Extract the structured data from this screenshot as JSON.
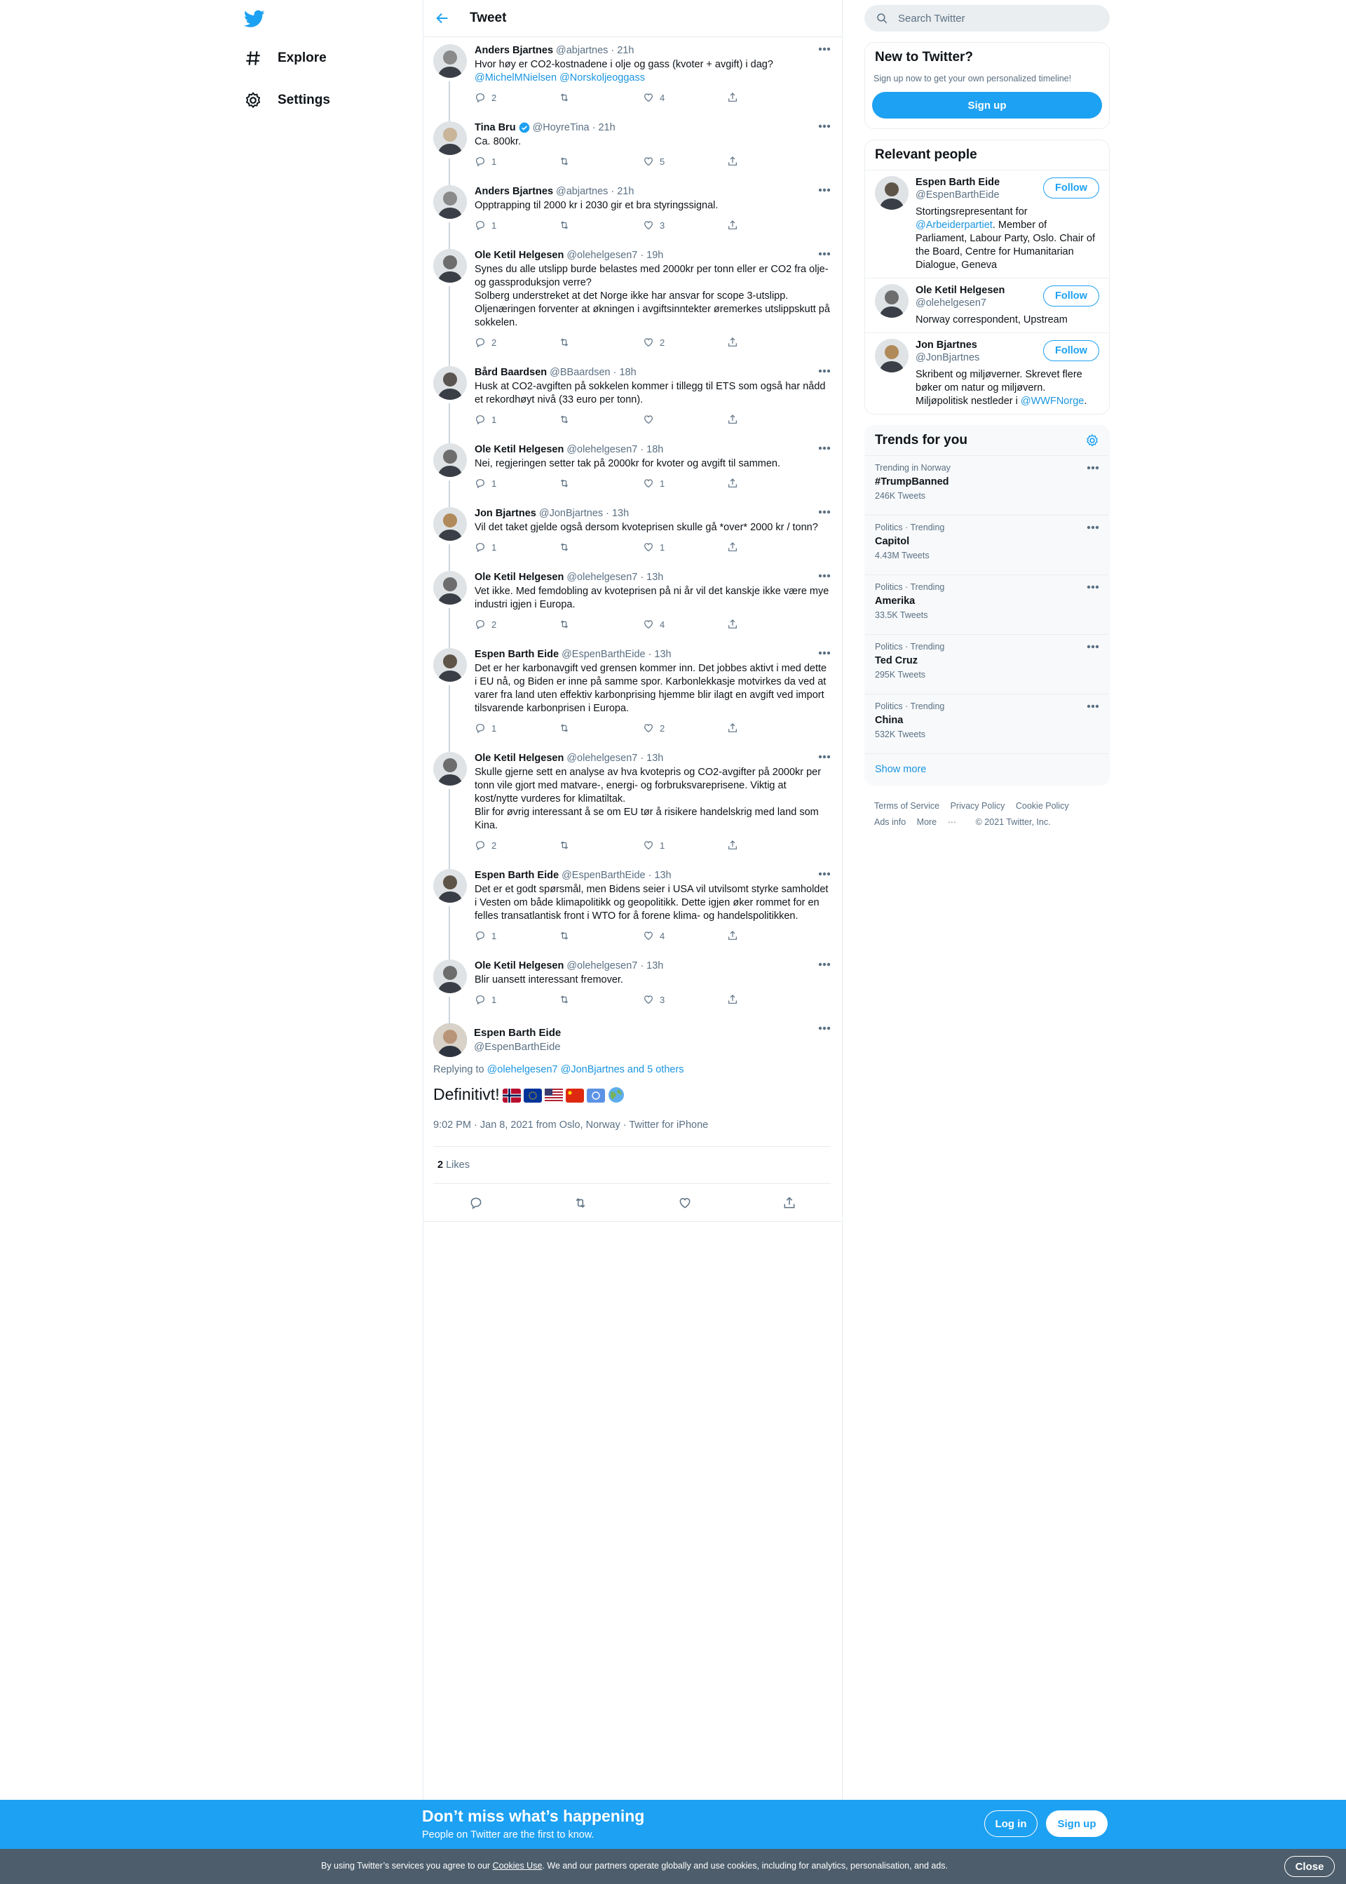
{
  "nav": {
    "explore_label": "Explore",
    "settings_label": "Settings"
  },
  "header": {
    "title": "Tweet"
  },
  "thread": [
    {
      "name": "Anders Bjartnes",
      "handle": "@abjartnes",
      "time": "21h",
      "text": "Hvor høy er CO2-kostnadene i olje og gass (kvoter + avgift) i dag?",
      "mentions": "@MichelMNielsen @Norskoljeoggass",
      "replies": "2",
      "retweets": "",
      "likes": "4",
      "avatar_color": "#8a8a8a",
      "verified": false
    },
    {
      "name": "Tina Bru",
      "handle": "@HoyreTina",
      "time": "21h",
      "text": "Ca. 800kr.",
      "mentions": "",
      "replies": "1",
      "retweets": "",
      "likes": "5",
      "avatar_color": "#c8b59a",
      "verified": true
    },
    {
      "name": "Anders Bjartnes",
      "handle": "@abjartnes",
      "time": "21h",
      "text": "Opptrapping til 2000 kr i 2030 gir et bra styringssignal.",
      "mentions": "",
      "replies": "1",
      "retweets": "",
      "likes": "3",
      "avatar_color": "#8a8a8a",
      "verified": false
    },
    {
      "name": "Ole Ketil Helgesen",
      "handle": "@olehelgesen7",
      "time": "19h",
      "text": "Synes du alle utslipp burde belastes med 2000kr per tonn eller er CO2 fra olje- og gassproduksjon verre?\nSolberg understreket at det Norge ikke har ansvar for scope 3-utslipp.\nOljenæringen forventer at økningen i avgiftsinntekter øremerkes utslippskutt på sokkelen.",
      "mentions": "",
      "replies": "2",
      "retweets": "",
      "likes": "2",
      "avatar_color": "#6d6d6d",
      "verified": false
    },
    {
      "name": "Bård Baardsen",
      "handle": "@BBaardsen",
      "time": "18h",
      "text": "Husk at CO2-avgiften på sokkelen kommer i tillegg til ETS som også har nådd et rekordhøyt nivå (33 euro per tonn).",
      "mentions": "",
      "replies": "1",
      "retweets": "",
      "likes": "",
      "avatar_color": "#5a5550",
      "verified": false
    },
    {
      "name": "Ole Ketil Helgesen",
      "handle": "@olehelgesen7",
      "time": "18h",
      "text": "Nei, regjeringen setter tak på 2000kr for kvoter og avgift til sammen.",
      "mentions": "",
      "replies": "1",
      "retweets": "",
      "likes": "1",
      "avatar_color": "#6d6d6d",
      "verified": false
    },
    {
      "name": "Jon Bjartnes",
      "handle": "@JonBjartnes",
      "time": "13h",
      "text": "Vil det taket gjelde også dersom kvoteprisen skulle gå *over* 2000 kr / tonn?",
      "mentions": "",
      "replies": "1",
      "retweets": "",
      "likes": "1",
      "avatar_color": "#b08a5a",
      "verified": false
    },
    {
      "name": "Ole Ketil Helgesen",
      "handle": "@olehelgesen7",
      "time": "13h",
      "text": "Vet ikke. Med femdobling av kvoteprisen på ni år vil det kanskje ikke være mye industri igjen i Europa.",
      "mentions": "",
      "replies": "2",
      "retweets": "",
      "likes": "4",
      "avatar_color": "#6d6d6d",
      "verified": false
    },
    {
      "name": "Espen Barth Eide",
      "handle": "@EspenBarthEide",
      "time": "13h",
      "text": "Det er her karbonavgift ved grensen kommer inn. Det jobbes aktivt i med dette i EU nå, og Biden er inne på samme spor. Karbonlekkasje motvirkes da ved at varer fra land uten effektiv karbonprising hjemme blir ilagt en avgift ved import tilsvarende karbonprisen i Europa.",
      "mentions": "",
      "replies": "1",
      "retweets": "",
      "likes": "2",
      "avatar_color": "#5e5448",
      "verified": false
    },
    {
      "name": "Ole Ketil Helgesen",
      "handle": "@olehelgesen7",
      "time": "13h",
      "text": "Skulle gjerne sett en analyse av hva kvotepris og CO2-avgifter på 2000kr per tonn vile gjort med matvare-, energi- og forbruksvareprisene. Viktig at kost/nytte vurderes for klimatiltak.\nBlir for øvrig interessant å se om EU tør å risikere handelskrig med land som Kina.",
      "mentions": "",
      "replies": "2",
      "retweets": "",
      "likes": "1",
      "avatar_color": "#6d6d6d",
      "verified": false
    },
    {
      "name": "Espen Barth Eide",
      "handle": "@EspenBarthEide",
      "time": "13h",
      "text": "Det er et godt spørsmål, men Bidens seier i USA vil utvilsomt styrke samholdet i Vesten om både klimapolitikk og geopolitikk. Dette igjen øker rommet for en felles transatlantisk front i WTO for å forene klima- og handelspolitikken.",
      "mentions": "",
      "replies": "1",
      "retweets": "",
      "likes": "4",
      "avatar_color": "#5e5448",
      "verified": false
    },
    {
      "name": "Ole Ketil Helgesen",
      "handle": "@olehelgesen7",
      "time": "13h",
      "text": "Blir uansett interessant fremover.",
      "mentions": "",
      "replies": "1",
      "retweets": "",
      "likes": "3",
      "avatar_color": "#6d6d6d",
      "verified": false
    }
  ],
  "main_tweet": {
    "name": "Espen Barth Eide",
    "handle": "@EspenBarthEide",
    "replying_prefix": "Replying to",
    "replying_to": "@olehelgesen7 @JonBjartnes and 5 others",
    "text": "Definitivt!",
    "flags": [
      "Norway",
      "EU",
      "USA",
      "China",
      "UN",
      "Earth"
    ],
    "date": "9:02 PM · Jan 8, 2021 from Oslo, Norway · Twitter for iPhone",
    "likes_count": "2",
    "likes_label": "Likes",
    "avatar_color": "#5e5448"
  },
  "search": {
    "placeholder": "Search Twitter"
  },
  "new_to_twitter": {
    "title": "New to Twitter?",
    "subtitle": "Sign up now to get your own personalized timeline!",
    "signup_label": "Sign up"
  },
  "relevant_people": {
    "title": "Relevant people",
    "follow_label": "Follow",
    "people": [
      {
        "name": "Espen Barth Eide",
        "handle": "@EspenBarthEide",
        "bio_pre": "Stortingsrepresentant for ",
        "bio_link": "@Arbeiderpartiet",
        "bio_post": ". Member of Parliament, Labour Party, Oslo. Chair of the Board, Centre for Humanitarian Dialogue, Geneva",
        "avatar_color": "#5e5448"
      },
      {
        "name": "Ole Ketil Helgesen",
        "handle": "@olehelgesen7",
        "bio_pre": "Norway correspondent, Upstream",
        "bio_link": "",
        "bio_post": "",
        "avatar_color": "#6d6d6d"
      },
      {
        "name": "Jon Bjartnes",
        "handle": "@JonBjartnes",
        "bio_pre": "Skribent og miljøverner. Skrevet flere bøker om natur og miljøvern. Miljøpolitisk nestleder i ",
        "bio_link": "@WWFNorge",
        "bio_post": ".",
        "avatar_color": "#b08a5a"
      }
    ]
  },
  "trends": {
    "title": "Trends for you",
    "items": [
      {
        "meta": "Trending in Norway",
        "name": "#TrumpBanned",
        "count": "246K Tweets"
      },
      {
        "meta": "Politics · Trending",
        "name": "Capitol",
        "count": "4.43M Tweets"
      },
      {
        "meta": "Politics · Trending",
        "name": "Amerika",
        "count": "33.5K Tweets"
      },
      {
        "meta": "Politics · Trending",
        "name": "Ted Cruz",
        "count": "295K Tweets"
      },
      {
        "meta": "Politics · Trending",
        "name": "China",
        "count": "532K Tweets"
      }
    ],
    "show_more": "Show more"
  },
  "footer": {
    "terms": "Terms of Service",
    "privacy": "Privacy Policy",
    "cookie": "Cookie Policy",
    "ads": "Ads info",
    "more": "More",
    "copyright": "© 2021 Twitter, Inc."
  },
  "banner": {
    "title": "Don’t miss what’s happening",
    "subtitle": "People on Twitter are the first to know.",
    "login_label": "Log in",
    "signup_label": "Sign up"
  },
  "cookie_bar": {
    "text_pre": "By using Twitter’s services you agree to our ",
    "link": "Cookies Use",
    "text_post": ". We and our partners operate globally and use cookies, including for analytics, personalisation, and ads.",
    "close_label": "Close"
  },
  "colors": {
    "brand": "#1da1f2",
    "link": "#1b95e0",
    "secondary_text": "#5b7083"
  }
}
